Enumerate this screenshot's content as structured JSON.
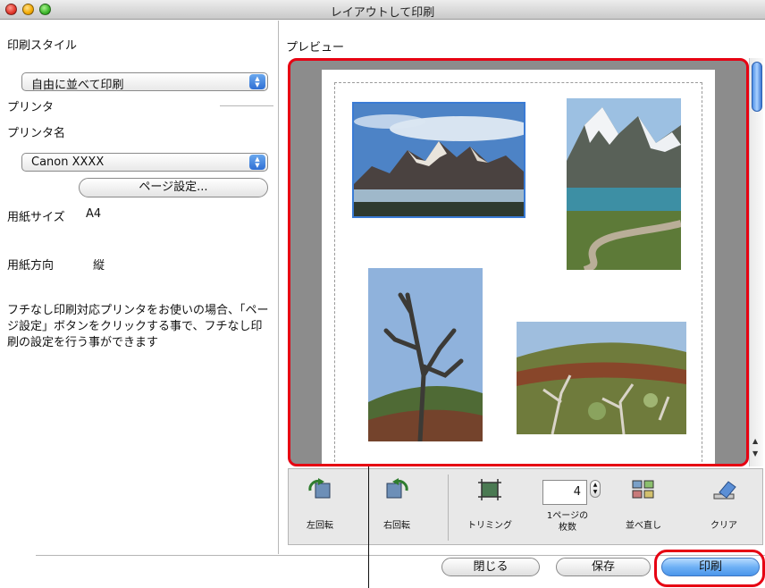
{
  "window": {
    "title": "レイアウトして印刷"
  },
  "left": {
    "print_style_label": "印刷スタイル",
    "print_style_value": "自由に並べて印刷",
    "printer_section_label": "プリンタ",
    "printer_name_label": "プリンタ名",
    "printer_name_value": "Canon XXXX",
    "page_setup_button": "ページ設定...",
    "paper_size_label": "用紙サイズ",
    "paper_size_value": "A4",
    "orientation_label": "用紙方向",
    "orientation_value": "縦",
    "note": "フチなし印刷対応プリンタをお使いの場合、「ページ設定」ボタンをクリックする事で、フチなし印刷の設定を行う事ができます"
  },
  "preview": {
    "label": "プレビュー",
    "photos": [
      "mountain-lake-photo",
      "mountain-road-photo",
      "dead-tree-photo",
      "hillside-trees-photo"
    ]
  },
  "toolbar": {
    "rotate_left": "左回転",
    "rotate_right": "右回転",
    "trimming": "トリミング",
    "copies_value": "4",
    "copies_label_line1": "1ページの",
    "copies_label_line2": "枚数",
    "rearrange": "並べ直し",
    "clear": "クリア"
  },
  "buttons": {
    "close": "閉じる",
    "save": "保存",
    "print": "印刷"
  },
  "colors": {
    "highlight": "#e60012",
    "accent": "#3a7bd5"
  }
}
